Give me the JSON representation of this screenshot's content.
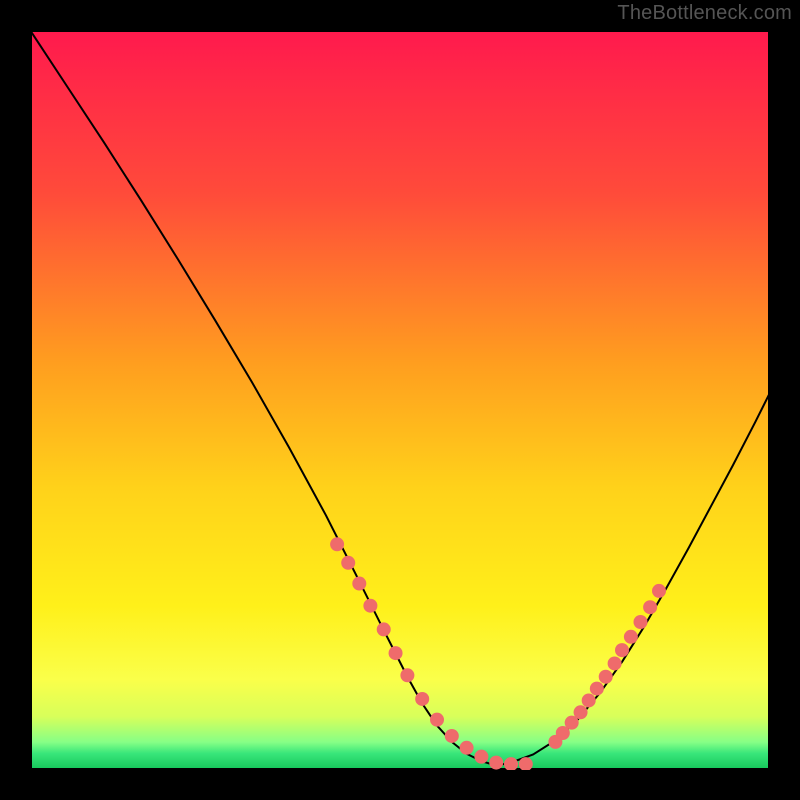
{
  "attribution": "TheBottleneck.com",
  "chart_data": {
    "type": "line",
    "title": "",
    "xlabel": "",
    "ylabel": "",
    "xlim": [
      0,
      100
    ],
    "ylim": [
      0,
      100
    ],
    "grid": false,
    "background_gradient_stops": [
      {
        "pos": 0,
        "color": "#ff1a4d"
      },
      {
        "pos": 22,
        "color": "#ff4b3a"
      },
      {
        "pos": 45,
        "color": "#ff9e1f"
      },
      {
        "pos": 62,
        "color": "#ffd21a"
      },
      {
        "pos": 78,
        "color": "#fff01a"
      },
      {
        "pos": 88,
        "color": "#faff4a"
      },
      {
        "pos": 93,
        "color": "#d8ff5a"
      },
      {
        "pos": 96.5,
        "color": "#86ff86"
      },
      {
        "pos": 98,
        "color": "#39e67a"
      },
      {
        "pos": 100,
        "color": "#18c95d"
      }
    ],
    "series": [
      {
        "name": "curve-left",
        "style": "line",
        "color": "#000000",
        "x": [
          0,
          5,
          10,
          15,
          20,
          25,
          30,
          35,
          40,
          44,
          48,
          51,
          53,
          55,
          57,
          59,
          61,
          63
        ],
        "y": [
          100,
          92.4,
          84.8,
          77,
          69,
          60.8,
          52.4,
          43.6,
          34.4,
          26.5,
          18.5,
          12.6,
          9,
          6,
          3.8,
          2.2,
          1.2,
          0.6
        ]
      },
      {
        "name": "curve-right",
        "style": "line",
        "color": "#000000",
        "x": [
          63,
          65,
          68,
          71,
          74,
          77,
          80,
          83,
          86,
          89,
          92,
          95,
          98,
          100
        ],
        "y": [
          0.6,
          1.0,
          2.1,
          4.0,
          6.8,
          10.4,
          14.6,
          19.4,
          24.6,
          30.0,
          35.6,
          41.2,
          47.0,
          51.0
        ]
      },
      {
        "name": "markers-left",
        "style": "scatter",
        "color": "#ef6b6b",
        "x": [
          41.5,
          43.0,
          44.5,
          46.0,
          47.8,
          49.4,
          51.0,
          53.0,
          55.0,
          57.0,
          59.0,
          61.0,
          63.0,
          65.0,
          67.0
        ],
        "y": [
          30.5,
          28.0,
          25.2,
          22.2,
          19.0,
          15.8,
          12.8,
          9.6,
          6.8,
          4.6,
          3.0,
          1.8,
          1.0,
          0.8,
          0.8
        ]
      },
      {
        "name": "markers-right",
        "style": "scatter",
        "color": "#ef6b6b",
        "x": [
          71.0,
          72.0,
          73.2,
          74.4,
          75.5,
          76.6,
          77.8,
          79.0,
          80.0,
          81.2,
          82.5,
          83.8,
          85.0
        ],
        "y": [
          3.8,
          5.0,
          6.4,
          7.8,
          9.4,
          11.0,
          12.6,
          14.4,
          16.2,
          18.0,
          20.0,
          22.0,
          24.2
        ]
      }
    ]
  }
}
